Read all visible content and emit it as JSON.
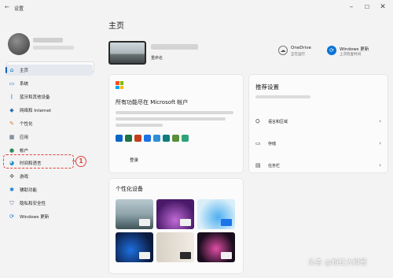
{
  "window": {
    "title": "设置"
  },
  "search": {
    "placeholder": "查找设置"
  },
  "sidebar": {
    "items": [
      {
        "label": "主页",
        "icon": "home-icon",
        "active": true
      },
      {
        "label": "系统",
        "icon": "monitor-icon"
      },
      {
        "label": "蓝牙和其他设备",
        "icon": "bluetooth-icon"
      },
      {
        "label": "网络和 Internet",
        "icon": "wifi-icon"
      },
      {
        "label": "个性化",
        "icon": "brush-icon"
      },
      {
        "label": "应用",
        "icon": "apps-icon"
      },
      {
        "label": "帐户",
        "icon": "account-icon"
      },
      {
        "label": "时间和语言",
        "icon": "globe-clock-icon"
      },
      {
        "label": "游戏",
        "icon": "gamepad-icon"
      },
      {
        "label": "辅助功能",
        "icon": "accessibility-icon"
      },
      {
        "label": "隐私和安全性",
        "icon": "shield-icon"
      },
      {
        "label": "Windows 更新",
        "icon": "sync-icon"
      }
    ]
  },
  "callout": {
    "number": "1",
    "color": "#e0443c"
  },
  "main": {
    "title": "主页",
    "device": {
      "rename": "重命名"
    },
    "quick": [
      {
        "label": "OneDrive",
        "sub": "正在运行",
        "icon": "cloud-icon"
      },
      {
        "label": "Windows 更新",
        "sub": "上次检查时间",
        "icon": "sync-icon"
      }
    ]
  },
  "ms_card": {
    "title": "所有功能尽在 Microsoft 帐户",
    "button": "登录"
  },
  "rec_card": {
    "title": "推荐设置",
    "rows": [
      {
        "label": "语言和区域",
        "icon": "language-icon"
      },
      {
        "label": "存储",
        "icon": "storage-icon"
      },
      {
        "label": "任务栏",
        "icon": "taskbar-icon"
      }
    ]
  },
  "pers_card": {
    "title": "个性化设备"
  },
  "watermark": "头条 @粉红大拇哥",
  "colors": {
    "accent": "#0067c0",
    "callout": "#e0443c"
  }
}
